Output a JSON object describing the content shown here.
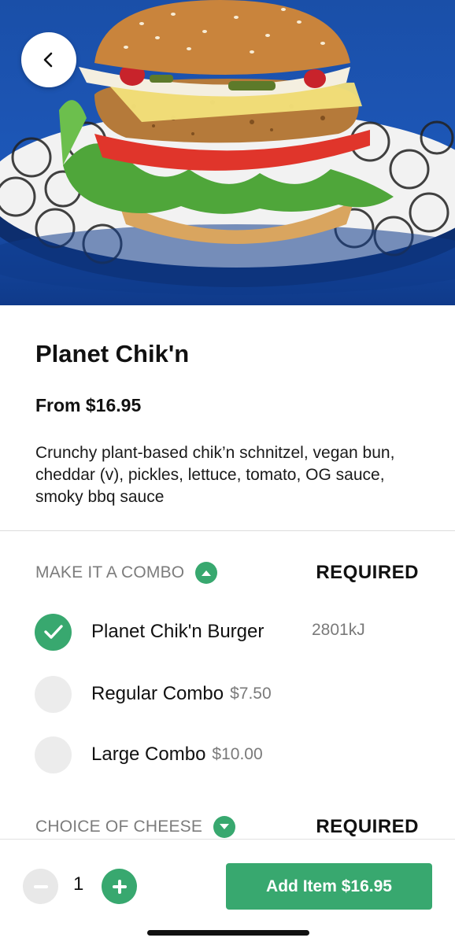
{
  "hero": {
    "image_alt": "Planet Chik'n burger on a tray"
  },
  "back": {
    "icon": "chevron-left-icon"
  },
  "product": {
    "title": "Planet Chik'n",
    "price": "From $16.95",
    "description": "Crunchy plant-based chik’n schnitzel, vegan bun, cheddar (v), pickles, lettuce, tomato, OG sauce, smoky bbq sauce"
  },
  "combo_section": {
    "label": "MAKE IT A COMBO",
    "required": "REQUIRED",
    "expanded": true,
    "options": [
      {
        "label": "Planet Chik'n Burger",
        "extra": "",
        "kj": "2801kJ",
        "selected": true
      },
      {
        "label": "Regular Combo",
        "extra": "$7.50",
        "selected": false
      },
      {
        "label": "Large Combo",
        "extra": "$10.00",
        "selected": false
      }
    ]
  },
  "cheese_section": {
    "label": "CHOICE OF CHEESE",
    "required": "REQUIRED",
    "expanded": false
  },
  "footer": {
    "quantity": "1",
    "add_button": "Add Item $16.95"
  },
  "colors": {
    "accent": "#38a86f",
    "hero_bg": "#1d57b8",
    "muted": "#7c7c7c"
  }
}
